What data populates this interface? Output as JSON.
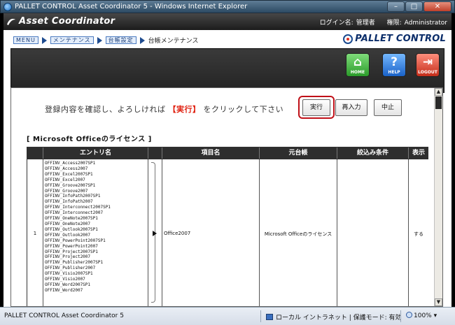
{
  "window": {
    "title": "PALLET CONTROL Asset Coordinator 5 - Windows Internet Explorer",
    "controls": [
      "–",
      "□",
      "✕"
    ]
  },
  "app": {
    "logo_text": "Asset Coordinator",
    "login_label": "ログイン名:",
    "login_value": "管理者",
    "role_label": "権限:",
    "role_value": "Administrator",
    "brand_text": "PALLET CONTROL"
  },
  "breadcrumb": {
    "menu": "MENU",
    "maintenance": "メンテナンス",
    "ledger_settings": "台帳設定",
    "current": "台帳メンテナンス"
  },
  "toolbar": {
    "home": "HOME",
    "help": "HELP",
    "logout": "LOGOUT"
  },
  "confirm": {
    "text_before": "登録内容を確認し、よろしければ",
    "highlight": "【実行】",
    "text_after": "をクリックして下さい",
    "exec_button": "実行",
    "reenter_button": "再入力",
    "cancel_button": "中止"
  },
  "section": {
    "title": "[ Microsoft Officeのライセンス ]"
  },
  "table": {
    "headers": {
      "entry": "エントリ名",
      "item": "項目名",
      "source": "元台帳",
      "filter": "絞込み条件",
      "display": "表示"
    },
    "row": {
      "number": "1",
      "entries": [
        "OFFINV_Access2007SP1",
        "OFFINV_Access2007",
        "OFFINV_Excel2007SP1",
        "OFFINV_Excel2007",
        "OFFINV_Groove2007SP1",
        "OFFINV_Groove2007",
        "OFFINV_InfoPath2007SP1",
        "OFFINV_InfoPath2007",
        "OFFINV_Interconnect2007SP1",
        "OFFINV_Interconnect2007",
        "OFFINV_OneNote2007SP1",
        "OFFINV_OneNote2007",
        "OFFINV_Outlook2007SP1",
        "OFFINV_Outlook2007",
        "OFFINV_PowerPoint2007SP1",
        "OFFINV_PowerPoint2007",
        "OFFINV_Project2007SP1",
        "OFFINV_Project2007",
        "OFFINV_Publisher2007SP1",
        "OFFINV_Publisher2007",
        "OFFINV_Visio2007SP1",
        "OFFINV_Visio2007",
        "OFFINV_Word2007SP1",
        "OFFINV_Word2007"
      ],
      "item_name": "Office2007",
      "source_ledger": "Microsoft Officeのライセンス",
      "filter": "",
      "display": "する"
    }
  },
  "statusbar": {
    "left_text": "PALLET CONTROL Asset Coordinator 5",
    "zone_text": "ローカル イントラネット | 保護モード: 有効",
    "zoom": "100%"
  }
}
